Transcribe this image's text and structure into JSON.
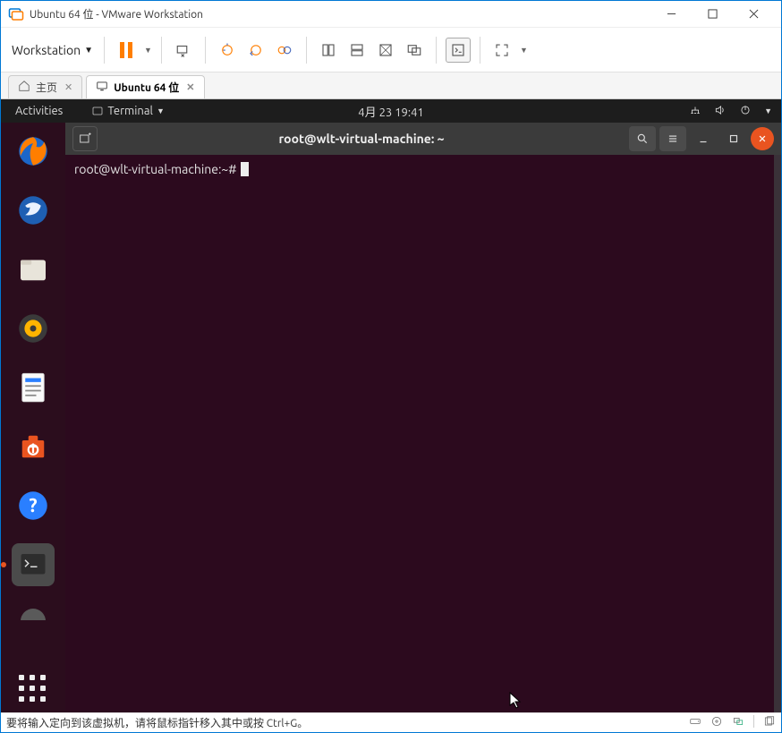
{
  "window": {
    "title": "Ubuntu 64 位 - VMware Workstation",
    "menu_label": "Workstation"
  },
  "tabs": {
    "home_label": "主页",
    "vm_label": "Ubuntu 64 位"
  },
  "gnome": {
    "activities": "Activities",
    "app_menu": "Terminal",
    "datetime": "4月 23  19:41"
  },
  "terminal": {
    "title": "root@wlt-virtual-machine: ~",
    "prompt": "root@wlt-virtual-machine:~#"
  },
  "dock": {
    "items": [
      "firefox",
      "thunderbird",
      "files",
      "rhythmbox",
      "writer",
      "software",
      "help",
      "terminal",
      "settings"
    ],
    "active_index": 7
  },
  "status": {
    "message": "要将输入定向到该虚拟机，请将鼠标指针移入其中或按 Ctrl+G。"
  }
}
